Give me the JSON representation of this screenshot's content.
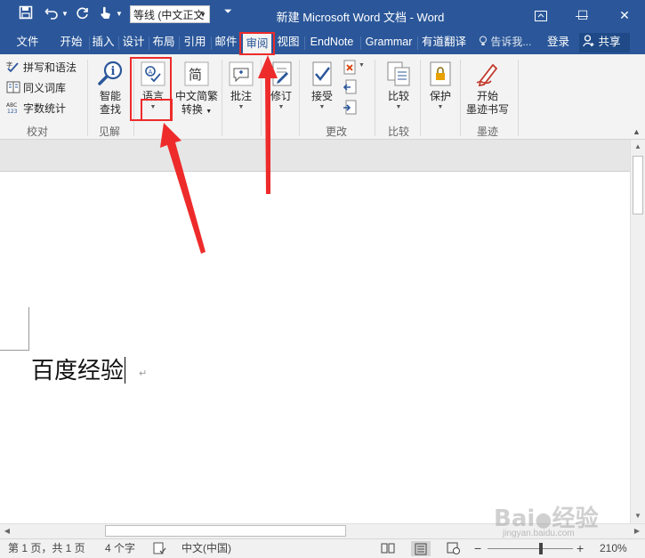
{
  "window": {
    "title": "新建 Microsoft Word 文档 - Word",
    "minimize": "—",
    "maximize": "☐",
    "close": "✕"
  },
  "quick_access": {
    "font_name": "等线 (中文正文",
    "customize": "⏷"
  },
  "tabs": [
    {
      "label": "文件"
    },
    {
      "label": "开始"
    },
    {
      "label": "插入"
    },
    {
      "label": "设计"
    },
    {
      "label": "布局"
    },
    {
      "label": "引用"
    },
    {
      "label": "邮件"
    },
    {
      "label": "审阅",
      "active": true
    },
    {
      "label": "视图"
    },
    {
      "label": "EndNote"
    },
    {
      "label": "Grammar"
    },
    {
      "label": "有道翻译"
    }
  ],
  "tell_me": "告诉我...",
  "login": "登录",
  "share": "共享",
  "ribbon": {
    "proofing": {
      "spelling": "拼写和语法",
      "thesaurus": "同义词库",
      "word_count": "字数统计",
      "group_label": "校对"
    },
    "insights": {
      "smart_lookup_line1": "智能",
      "smart_lookup_line2": "查找",
      "group_label": "见解"
    },
    "language": {
      "language_label": "语言",
      "chinese_convert_line1": "中文简繁",
      "chinese_convert_line2": "转换"
    },
    "comments": {
      "new_comment": "批注"
    },
    "tracking": {
      "track_changes": "修订"
    },
    "changes": {
      "accept": "接受",
      "group_label": "更改"
    },
    "compare": {
      "compare": "比较",
      "group_label": "比较"
    },
    "protect": {
      "protect": "保护"
    },
    "ink": {
      "start_inking_line1": "开始",
      "start_inking_line2": "墨迹书写",
      "group_label": "墨迹"
    }
  },
  "document": {
    "text": "百度经验",
    "para_mark": "↵"
  },
  "status_bar": {
    "page": "第 1 页，共 1 页",
    "words": "4 个字",
    "language": "中文(中国)",
    "zoom": "210%",
    "zoom_minus": "−",
    "zoom_plus": "+"
  },
  "colors": {
    "title_bar": "#2b579a",
    "ribbon_bg": "#f3f3f3",
    "annotation": "#ee2b2b"
  },
  "watermark": {
    "brand": "Bai",
    "brand_suffix": "经验",
    "url": "jingyan.baidu.com"
  }
}
